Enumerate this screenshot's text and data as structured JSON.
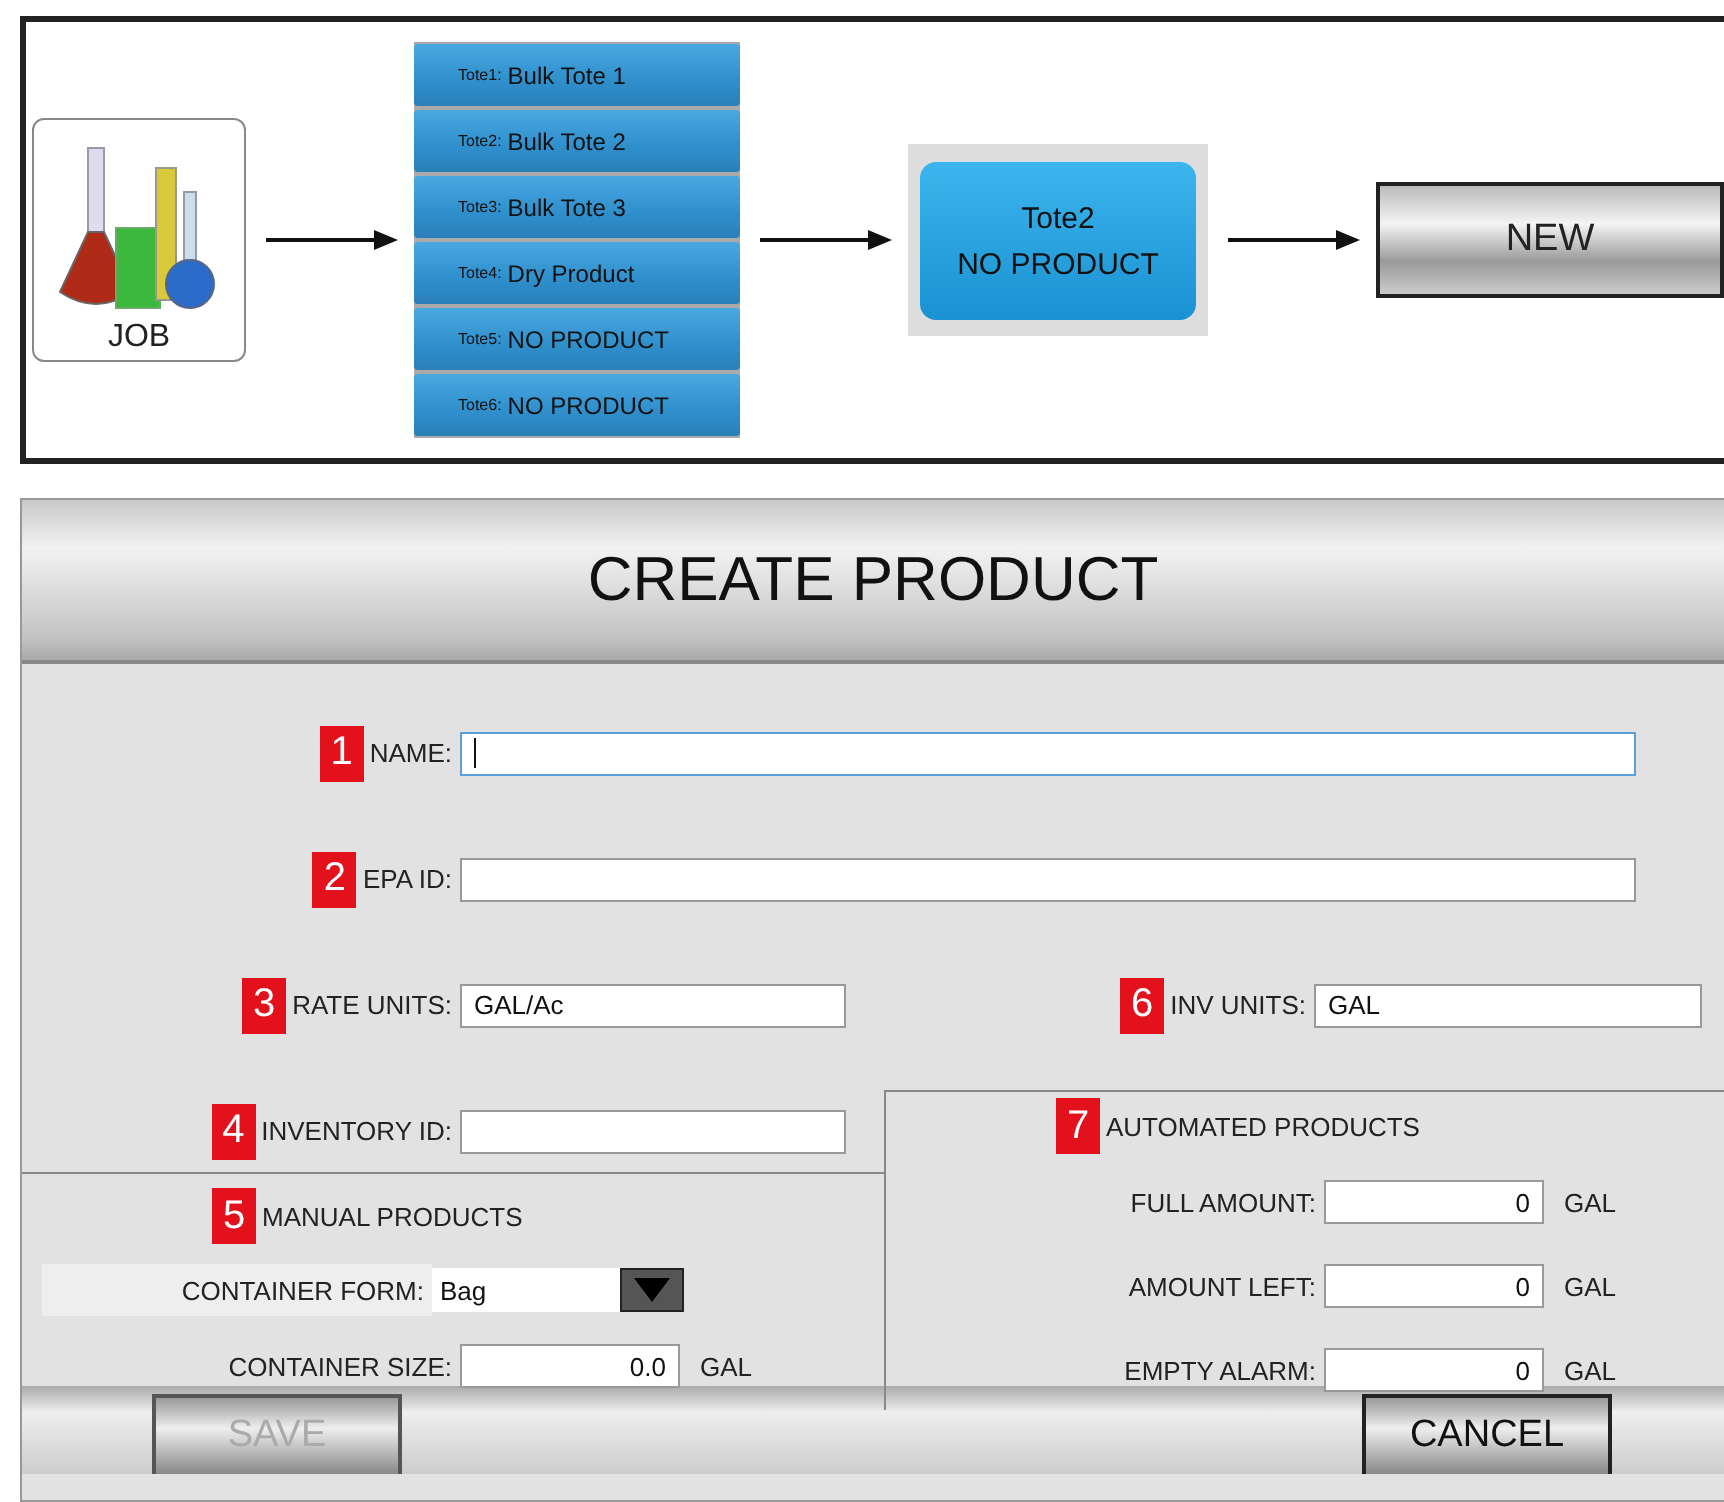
{
  "diagram": {
    "job_button": {
      "label": "JOB"
    },
    "totes": [
      {
        "prefix": "Tote1:",
        "name": "Bulk Tote 1"
      },
      {
        "prefix": "Tote2:",
        "name": "Bulk Tote 2"
      },
      {
        "prefix": "Tote3:",
        "name": "Bulk Tote 3"
      },
      {
        "prefix": "Tote4:",
        "name": "Dry Product"
      },
      {
        "prefix": "Tote5:",
        "name": "NO PRODUCT"
      },
      {
        "prefix": "Tote6:",
        "name": "NO PRODUCT"
      }
    ],
    "selected_tote": {
      "title": "Tote2",
      "product": "NO PRODUCT"
    },
    "new_button": {
      "label": "NEW"
    }
  },
  "form": {
    "title": "CREATE PRODUCT",
    "name": {
      "badge": "1",
      "label": "NAME:",
      "focused": true
    },
    "epa_id": {
      "badge": "2",
      "label": "EPA ID:",
      "focused": false
    },
    "rate_units": {
      "badge": "3",
      "label": "RATE UNITS:",
      "value": "GAL/Ac"
    },
    "inv_units": {
      "badge": "6",
      "label": "INV UNITS:",
      "value": "GAL"
    },
    "inventory_id": {
      "badge": "4",
      "label": "INVENTORY ID:"
    },
    "manual_products": {
      "badge": "5",
      "title": "MANUAL PRODUCTS",
      "container_form": {
        "label": "CONTAINER FORM:",
        "value": "Bag"
      },
      "container_size": {
        "label": "CONTAINER SIZE:",
        "value": "0.0",
        "unit": "GAL"
      }
    },
    "automated_products": {
      "badge": "7",
      "title": "AUTOMATED PRODUCTS",
      "rows": [
        {
          "label": "FULL AMOUNT:",
          "value": "0",
          "unit": "GAL"
        },
        {
          "label": "AMOUNT LEFT:",
          "value": "0",
          "unit": "GAL"
        },
        {
          "label": "EMPTY ALARM:",
          "value": "0",
          "unit": "GAL"
        }
      ]
    },
    "buttons": [
      {
        "label": "SAVE",
        "disabled": true
      },
      {
        "label": "CANCEL",
        "disabled": false
      }
    ]
  }
}
